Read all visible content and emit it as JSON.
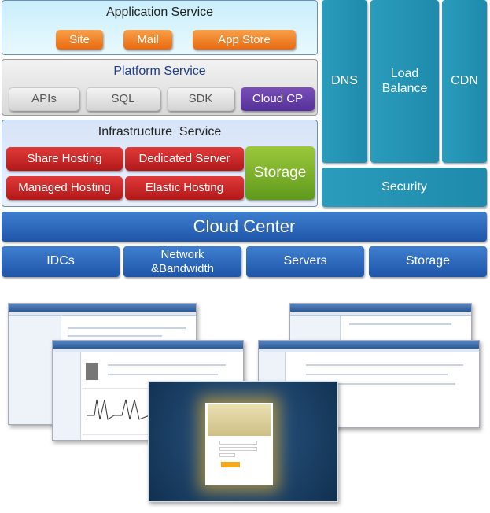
{
  "application_service": {
    "title": "Application Service",
    "items": [
      "Site",
      "Mail",
      "App Store"
    ]
  },
  "platform_service": {
    "title": "Platform Service",
    "items": [
      "APIs",
      "SQL",
      "SDK",
      "Cloud CP"
    ]
  },
  "infrastructure_service": {
    "title": "Infrastructure  Service",
    "items": [
      "Share Hosting",
      "Dedicated Server",
      "Managed Hosting",
      "Elastic Hosting"
    ],
    "storage": "Storage"
  },
  "side_services": {
    "dns": "DNS",
    "load_balance": "Load\nBalance",
    "cdn": "CDN",
    "security": "Security"
  },
  "cloud_center": "Cloud Center",
  "base_layer": [
    "IDCs",
    "Network\n&Bandwidth",
    "Servers",
    "Storage"
  ],
  "colors": {
    "orange": "#e86a10",
    "purple": "#55309a",
    "red": "#b31818",
    "green": "#6fa52a",
    "teal": "#2196b6",
    "blue": "#2a62b6"
  }
}
